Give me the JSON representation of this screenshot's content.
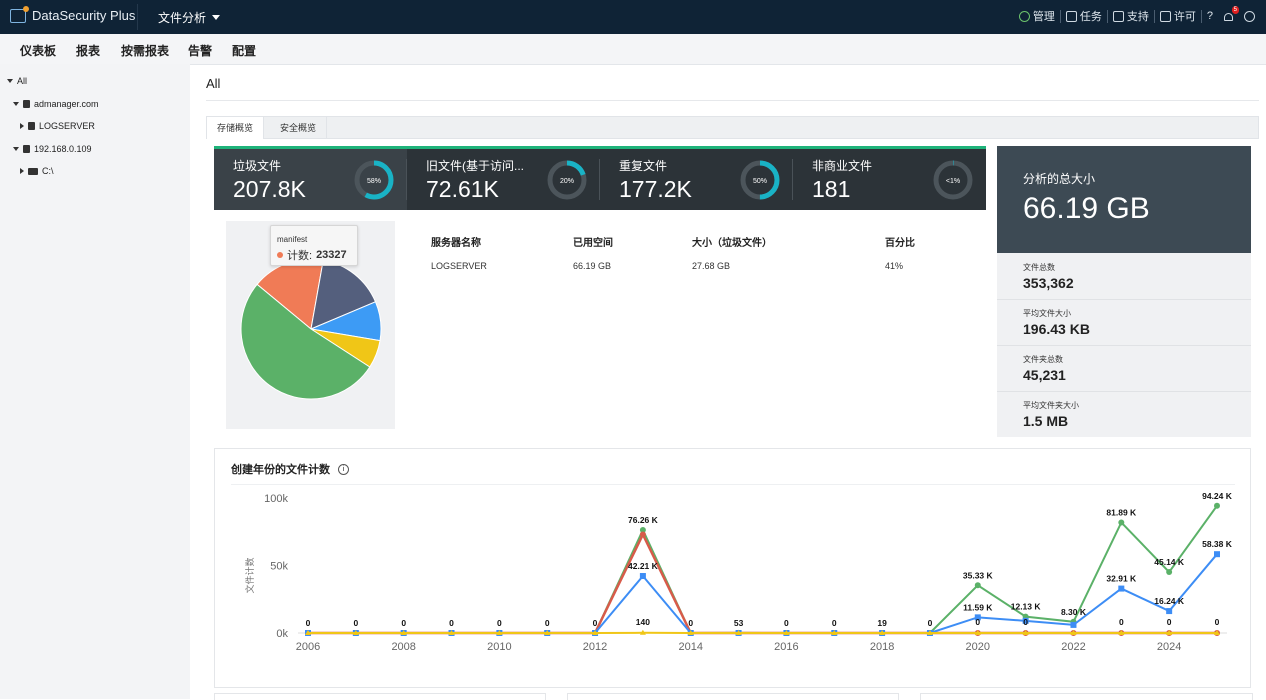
{
  "app": {
    "name": "DataSecurity Plus",
    "module": "文件分析"
  },
  "topbar": {
    "manage": "管理",
    "tasks": "任务",
    "support": "支持",
    "license": "许可",
    "help": "?",
    "notif_count": "5"
  },
  "menu": [
    "仪表板",
    "报表",
    "按需报表",
    "告警",
    "配置"
  ],
  "tree": {
    "all": "All",
    "domain": "admanager.com",
    "server": "LOGSERVER",
    "ip": "192.168.0.109",
    "drive": "C:\\"
  },
  "page_title": "All",
  "tabs": [
    "存储概览",
    "安全概览"
  ],
  "cards": [
    {
      "label": "垃圾文件",
      "value": "207.8K",
      "pct_label": "58%",
      "pct": 58
    },
    {
      "label": "旧文件(基于访问...",
      "value": "72.61K",
      "pct_label": "20%",
      "pct": 20
    },
    {
      "label": "重复文件",
      "value": "177.2K",
      "pct_label": "50%",
      "pct": 50
    },
    {
      "label": "非商业文件",
      "value": "181",
      "pct_label": "<1%",
      "pct": 0.5
    }
  ],
  "tooltip": {
    "title": "manifest",
    "label": "计数:",
    "value": "23327"
  },
  "table": {
    "headers": [
      "服务器名称",
      "已用空间",
      "大小（垃圾文件）",
      "百分比"
    ],
    "row": [
      "LOGSERVER",
      "66.19 GB",
      "27.68 GB",
      "41%"
    ]
  },
  "summary": {
    "label": "分析的总大小",
    "value": "66.19 GB"
  },
  "stats": [
    {
      "label": "文件总数",
      "value": "353,362"
    },
    {
      "label": "平均文件大小",
      "value": "196.43 KB"
    },
    {
      "label": "文件夹总数",
      "value": "45,231"
    },
    {
      "label": "平均文件夹大小",
      "value": "1.5 MB"
    }
  ],
  "chart_title": "创建年份的文件计数",
  "chart_data": [
    {
      "type": "pie",
      "slices": [
        {
          "name": "manifest",
          "value": 23327,
          "color": "#f07b56"
        },
        {
          "name": "",
          "value": 22000,
          "color": "#545f7d"
        },
        {
          "name": "",
          "value": 12500,
          "color": "#3d9bf5"
        },
        {
          "name": "",
          "value": 9000,
          "color": "#f0c617"
        },
        {
          "name": "",
          "value": 72000,
          "color": "#5bb168"
        }
      ]
    },
    {
      "type": "line",
      "title": "创建年份的文件计数",
      "ylabel": "文件计数",
      "xlabel": "",
      "ylim": [
        0,
        100000
      ],
      "yticks": [
        "0k",
        "50k",
        "100k"
      ],
      "xticks": [
        "2006",
        "2008",
        "2010",
        "2012",
        "2014",
        "2016",
        "2018",
        "2020",
        "2022",
        "2024"
      ],
      "x": [
        2006,
        2007,
        2008,
        2009,
        2010,
        2011,
        2012,
        2013,
        2014,
        2015,
        2016,
        2017,
        2018,
        2019,
        2020,
        2021,
        2022,
        2023,
        2024,
        2025
      ],
      "series": [
        {
          "color": "#5bb168",
          "values": [
            0,
            0,
            0,
            0,
            0,
            0,
            0,
            76260,
            0,
            53,
            0,
            0,
            19,
            0,
            35330,
            12130,
            8300,
            81890,
            45140,
            94240
          ]
        },
        {
          "color": "#d85b4a",
          "values": [
            0,
            0,
            0,
            0,
            0,
            0,
            0,
            73000,
            0,
            0,
            0,
            0,
            0,
            0,
            0,
            0,
            0,
            0,
            0,
            0
          ]
        },
        {
          "color": "#3d8df5",
          "values": [
            0,
            0,
            0,
            0,
            0,
            0,
            0,
            42210,
            0,
            0,
            0,
            0,
            0,
            0,
            11590,
            9000,
            6000,
            32910,
            16240,
            58380
          ]
        },
        {
          "color": "#f0c617",
          "values": [
            0,
            0,
            0,
            0,
            0,
            0,
            0,
            140,
            0,
            0,
            0,
            0,
            0,
            0,
            0,
            0,
            0,
            0,
            0,
            0
          ]
        }
      ],
      "labels": [
        {
          "x": 2006,
          "text": "0",
          "y": 0
        },
        {
          "x": 2007,
          "text": "0",
          "y": 0
        },
        {
          "x": 2008,
          "text": "0",
          "y": 0
        },
        {
          "x": 2009,
          "text": "0",
          "y": 0
        },
        {
          "x": 2010,
          "text": "0",
          "y": 0
        },
        {
          "x": 2011,
          "text": "0",
          "y": 0
        },
        {
          "x": 2012,
          "text": "0",
          "y": 0
        },
        {
          "x": 2013,
          "text": "76.26 K",
          "y": 76260
        },
        {
          "x": 2013,
          "text": "42.21 K",
          "y": 42210
        },
        {
          "x": 2013,
          "text": "140",
          "y": 0
        },
        {
          "x": 2014,
          "text": "0",
          "y": 0
        },
        {
          "x": 2015,
          "text": "53",
          "y": 0
        },
        {
          "x": 2016,
          "text": "0",
          "y": 0
        },
        {
          "x": 2017,
          "text": "0",
          "y": 0
        },
        {
          "x": 2018,
          "text": "19",
          "y": 0
        },
        {
          "x": 2019,
          "text": "0",
          "y": 0
        },
        {
          "x": 2020,
          "text": "35.33 K",
          "y": 35330
        },
        {
          "x": 2020,
          "text": "11.59 K",
          "y": 11590
        },
        {
          "x": 2020,
          "text": "0",
          "y": 0
        },
        {
          "x": 2021,
          "text": "12.13 K",
          "y": 12130
        },
        {
          "x": 2021,
          "text": "0",
          "y": 0
        },
        {
          "x": 2022,
          "text": "8.30 K",
          "y": 8300
        },
        {
          "x": 2023,
          "text": "81.89 K",
          "y": 81890
        },
        {
          "x": 2023,
          "text": "32.91 K",
          "y": 32910
        },
        {
          "x": 2023,
          "text": "0",
          "y": 0
        },
        {
          "x": 2024,
          "text": "45.14 K",
          "y": 45140
        },
        {
          "x": 2024,
          "text": "16.24 K",
          "y": 16240
        },
        {
          "x": 2024,
          "text": "0",
          "y": 0
        },
        {
          "x": 2025,
          "text": "94.24 K",
          "y": 94240
        },
        {
          "x": 2025,
          "text": "58.38 K",
          "y": 58380
        },
        {
          "x": 2025,
          "text": "0",
          "y": 0
        }
      ]
    }
  ]
}
